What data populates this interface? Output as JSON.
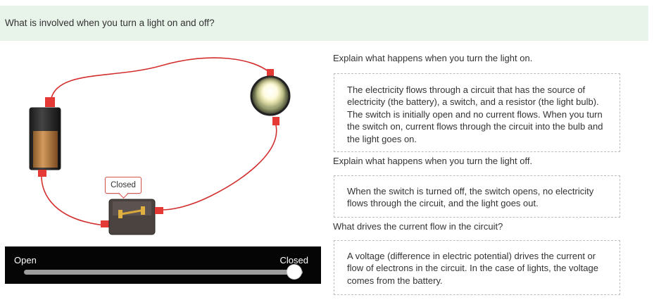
{
  "header": {
    "question": "What is involved when you turn a light on and off?"
  },
  "simulation": {
    "switch_tooltip": "Closed",
    "slider": {
      "left_label": "Open",
      "right_label": "Closed",
      "value": 1.0
    },
    "components": [
      "battery-icon",
      "light-bulb-icon",
      "switch-icon",
      "wire-icon"
    ]
  },
  "qa": [
    {
      "question": "Explain what happens when you turn the light on.",
      "answer": "The electricity flows through a circuit that has the source of electricity (the battery), a switch, and a resistor (the light bulb). The switch is initially open and no current flows. When you turn the switch on, current flows through the circuit into the bulb and the light goes on."
    },
    {
      "question": "Explain what happens when you turn the light off.",
      "answer": "When the switch is turned off, the switch opens, no electricity flows through the circuit, and the light goes out."
    },
    {
      "question": "What drives the current flow in the circuit?",
      "answer": "A voltage (difference in electric potential) drives the current or flow of electrons in the circuit. In the case of lights, the voltage comes from the battery."
    }
  ],
  "colors": {
    "header_bg": "#e8f3ea",
    "wire": "#d32f2f",
    "connector": "#e53935",
    "slider_track": "#9e9e9e"
  }
}
